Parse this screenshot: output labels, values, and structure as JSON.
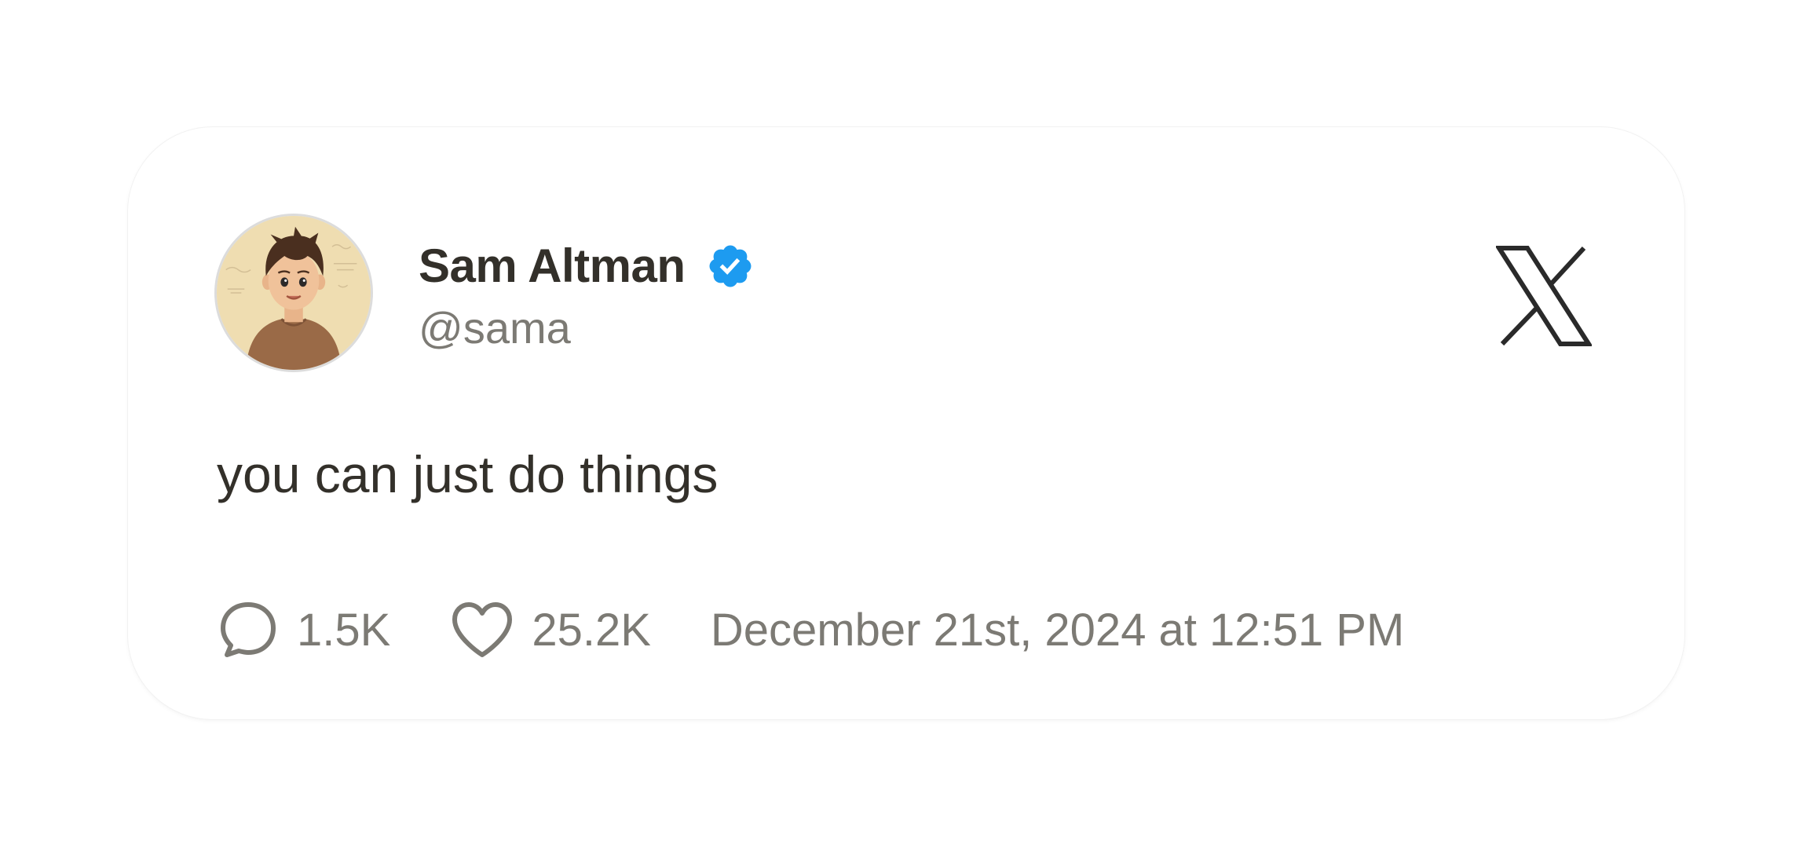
{
  "tweet": {
    "author": {
      "display_name": "Sam Altman",
      "handle": "@sama",
      "verified": true,
      "avatar_icon": "cartoon-avatar"
    },
    "text": "you can just do things",
    "stats": {
      "replies": "1.5K",
      "likes": "25.2K"
    },
    "timestamp": "December 21st, 2024 at 12:51 PM"
  },
  "icons": {
    "verified": "verified-badge-icon",
    "platform": "x-logo-icon",
    "reply": "speech-bubble-icon",
    "like": "heart-icon"
  },
  "colors": {
    "verified_blue": "#1d9bf0",
    "text_primary": "#33302a",
    "text_secondary": "#7c7a74"
  }
}
